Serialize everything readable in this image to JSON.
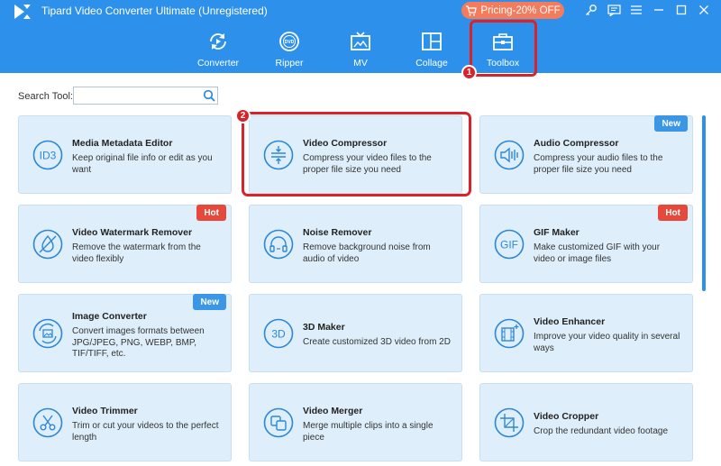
{
  "app": {
    "title": "Tipard Video Converter Ultimate (Unregistered)",
    "pricing_label": "Pricing-20% OFF"
  },
  "nav": {
    "items": [
      {
        "label": "Converter",
        "icon": "converter-icon"
      },
      {
        "label": "Ripper",
        "icon": "dvd-icon"
      },
      {
        "label": "MV",
        "icon": "tv-icon"
      },
      {
        "label": "Collage",
        "icon": "collage-icon"
      },
      {
        "label": "Toolbox",
        "icon": "toolbox-icon"
      }
    ],
    "active": "Toolbox"
  },
  "search": {
    "label": "Search Tool:",
    "value": "",
    "placeholder": ""
  },
  "annotations": {
    "step1": "1",
    "step2": "2",
    "color": "#d8232a"
  },
  "tags": {
    "hot": "Hot",
    "new": "New"
  },
  "colors": {
    "header": "#2d91eb",
    "card": "#deeffb",
    "icon": "#2d87d8",
    "hot": "#e8473b",
    "new": "#3b97e6",
    "pricing": "#f47c5d"
  },
  "tools": [
    {
      "title": "Media Metadata Editor",
      "desc": "Keep original file info or edit as you want",
      "icon": "id3-icon",
      "tag": ""
    },
    {
      "title": "Video Compressor",
      "desc": "Compress your video files to the proper file size you need",
      "icon": "compress-icon",
      "tag": ""
    },
    {
      "title": "Audio Compressor",
      "desc": "Compress your audio files to the proper file size you need",
      "icon": "audio-compress-icon",
      "tag": "New"
    },
    {
      "title": "Video Watermark Remover",
      "desc": "Remove the watermark from the video flexibly",
      "icon": "watermark-remover-icon",
      "tag": "Hot"
    },
    {
      "title": "Noise Remover",
      "desc": "Remove background noise from audio of video",
      "icon": "headphones-icon",
      "tag": ""
    },
    {
      "title": "GIF Maker",
      "desc": "Make customized GIF with your video or image files",
      "icon": "gif-icon",
      "tag": "Hot"
    },
    {
      "title": "Image Converter",
      "desc": "Convert images formats between JPG/JPEG, PNG, WEBP, BMP, TIF/TIFF, etc.",
      "icon": "image-converter-icon",
      "tag": "New"
    },
    {
      "title": "3D Maker",
      "desc": "Create customized 3D video from 2D",
      "icon": "3d-icon",
      "tag": ""
    },
    {
      "title": "Video Enhancer",
      "desc": "Improve your video quality in several ways",
      "icon": "enhancer-icon",
      "tag": ""
    },
    {
      "title": "Video Trimmer",
      "desc": "Trim or cut your videos to the perfect length",
      "icon": "scissors-icon",
      "tag": ""
    },
    {
      "title": "Video Merger",
      "desc": "Merge multiple clips into a single piece",
      "icon": "merge-icon",
      "tag": ""
    },
    {
      "title": "Video Cropper",
      "desc": "Crop the redundant video footage",
      "icon": "crop-icon",
      "tag": ""
    }
  ]
}
